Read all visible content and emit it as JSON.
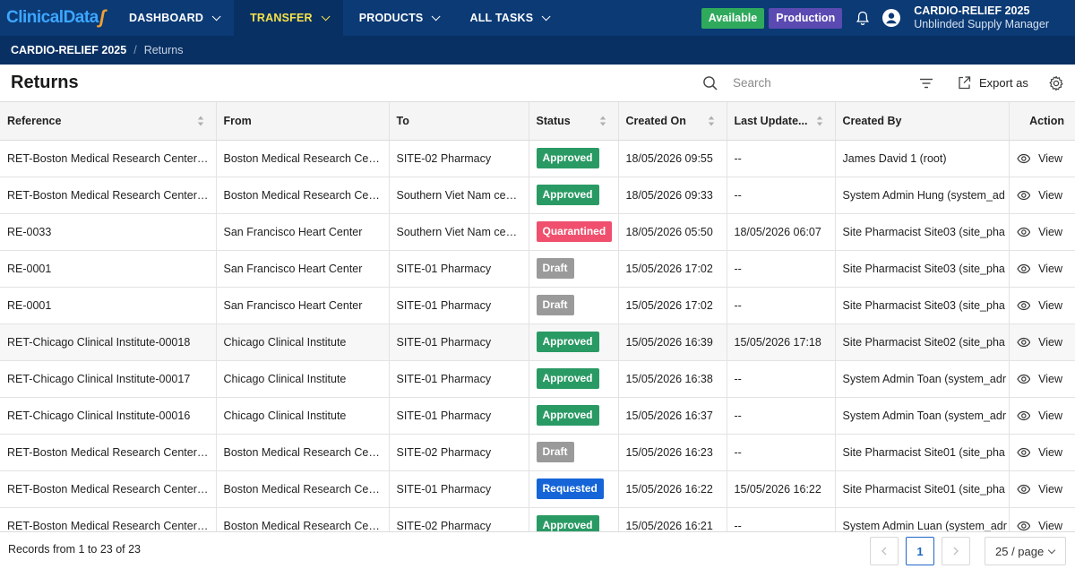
{
  "app": {
    "logo_text": "ClinicalData",
    "nav": [
      {
        "label": "DASHBOARD",
        "active": false
      },
      {
        "label": "TRANSFER",
        "active": true
      },
      {
        "label": "PRODUCTS",
        "active": false
      },
      {
        "label": "ALL TASKS",
        "active": false
      }
    ],
    "status_available": "Available",
    "status_env": "Production",
    "project_name": "CARDIO-RELIEF 2025",
    "user_role": "Unblinded Supply Manager",
    "colors": {
      "nav_bg": "#0b3a75",
      "active_nav_text": "#f6e24a",
      "available": "#2faa5c",
      "production": "#5b4ab2"
    }
  },
  "breadcrumb": {
    "project": "CARDIO-RELIEF 2025",
    "separator": "/",
    "page": "Returns"
  },
  "toolbar": {
    "title": "Returns",
    "search_placeholder": "Search",
    "export_label": "Export as"
  },
  "table": {
    "columns": [
      "Reference",
      "From",
      "To",
      "Status",
      "Created On",
      "Last Update...",
      "Created By",
      "Action"
    ],
    "status_colors": {
      "Approved": "#2a9a64",
      "Quarantined": "#f0506e",
      "Draft": "#9a9a9a",
      "Requested": "#1565d8"
    },
    "rows": [
      {
        "reference": "RET-Boston Medical Research Center-...",
        "from": "Boston Medical Research Center",
        "to": "SITE-02 Pharmacy",
        "status": "Approved",
        "created_on": "18/05/2026 09:55",
        "last_update": "--",
        "created_by": "James David 1 (root)",
        "action": "View"
      },
      {
        "reference": "RET-Boston Medical Research Center-...",
        "from": "Boston Medical Research Center",
        "to": "Southern Viet Nam center",
        "status": "Approved",
        "created_on": "18/05/2026 09:33",
        "last_update": "--",
        "created_by": "System Admin Hung (system_ad",
        "action": "View"
      },
      {
        "reference": "RE-0033",
        "from": "San Francisco Heart Center",
        "to": "Southern Viet Nam center",
        "status": "Quarantined",
        "created_on": "18/05/2026 05:50",
        "last_update": "18/05/2026 06:07",
        "created_by": "Site Pharmacist Site03 (site_pha",
        "action": "View"
      },
      {
        "reference": "RE-0001",
        "from": "San Francisco Heart Center",
        "to": "SITE-01 Pharmacy",
        "status": "Draft",
        "created_on": "15/05/2026 17:02",
        "last_update": "--",
        "created_by": "Site Pharmacist Site03 (site_pha",
        "action": "View"
      },
      {
        "reference": "RE-0001",
        "from": "San Francisco Heart Center",
        "to": "SITE-01 Pharmacy",
        "status": "Draft",
        "created_on": "15/05/2026 17:02",
        "last_update": "--",
        "created_by": "Site Pharmacist Site03 (site_pha",
        "action": "View"
      },
      {
        "reference": "RET-Chicago Clinical Institute-00018",
        "from": "Chicago Clinical Institute",
        "to": "SITE-01 Pharmacy",
        "status": "Approved",
        "created_on": "15/05/2026 16:39",
        "last_update": "15/05/2026 17:18",
        "created_by": "Site Pharmacist Site02 (site_pha",
        "action": "View"
      },
      {
        "reference": "RET-Chicago Clinical Institute-00017",
        "from": "Chicago Clinical Institute",
        "to": "SITE-01 Pharmacy",
        "status": "Approved",
        "created_on": "15/05/2026 16:38",
        "last_update": "--",
        "created_by": "System Admin Toan (system_adr",
        "action": "View"
      },
      {
        "reference": "RET-Chicago Clinical Institute-00016",
        "from": "Chicago Clinical Institute",
        "to": "SITE-01 Pharmacy",
        "status": "Approved",
        "created_on": "15/05/2026 16:37",
        "last_update": "--",
        "created_by": "System Admin Toan (system_adr",
        "action": "View"
      },
      {
        "reference": "RET-Boston Medical Research Center-...",
        "from": "Boston Medical Research Center",
        "to": "SITE-02 Pharmacy",
        "status": "Draft",
        "created_on": "15/05/2026 16:23",
        "last_update": "--",
        "created_by": "Site Pharmacist Site01 (site_pha",
        "action": "View"
      },
      {
        "reference": "RET-Boston Medical Research Center-...",
        "from": "Boston Medical Research Center",
        "to": "SITE-01 Pharmacy",
        "status": "Requested",
        "created_on": "15/05/2026 16:22",
        "last_update": "15/05/2026 16:22",
        "created_by": "Site Pharmacist Site01 (site_pha",
        "action": "View"
      },
      {
        "reference": "RET-Boston Medical Research Center-...",
        "from": "Boston Medical Research Center",
        "to": "SITE-02 Pharmacy",
        "status": "Approved",
        "created_on": "15/05/2026 16:21",
        "last_update": "--",
        "created_by": "System Admin Luan (system_adr",
        "action": "View"
      }
    ]
  },
  "footer": {
    "records_text": "Records from 1 to 23 of 23",
    "current_page": "1",
    "page_size": "25 / page"
  },
  "icons": [
    "chevron-down-icon",
    "bell-icon",
    "user-avatar-icon",
    "search-icon",
    "filter-icon",
    "export-icon",
    "settings-icon",
    "sort-icon",
    "eye-icon",
    "chevron-left-icon",
    "chevron-right-icon"
  ]
}
